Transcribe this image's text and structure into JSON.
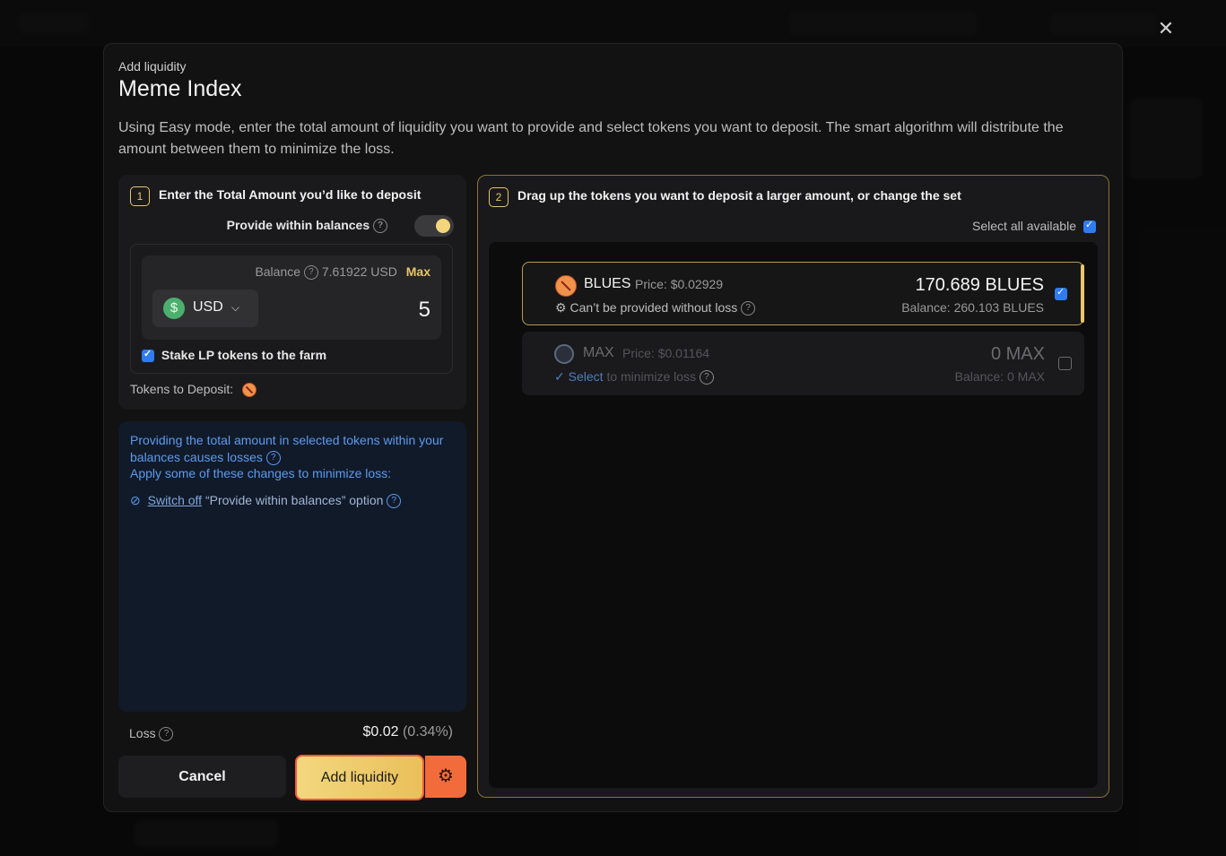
{
  "modal": {
    "subtitle": "Add liquidity",
    "title": "Meme Index",
    "description": "Using Easy mode, enter the total amount of liquidity you want to provide and select tokens you want to deposit. The smart algorithm will distribute the amount between them to minimize the loss.",
    "close_icon": "close-icon"
  },
  "step1": {
    "num": "1",
    "title": "Enter the Total Amount you’d like to deposit",
    "toggle_label": "Provide within balances",
    "toggle_on": true,
    "balance_label": "Balance",
    "balance_value": "7.61922 USD",
    "max_label": "Max",
    "currency": "USD",
    "currency_symbol": "$",
    "amount": "5",
    "stake_label": "Stake LP tokens to the farm",
    "stake_checked": true,
    "tokens_to_deposit_label": "Tokens to Deposit:"
  },
  "info": {
    "line1": "Providing the total amount in selected tokens within your balances causes losses",
    "line2": "Apply some of these changes to minimize loss:",
    "option_link": "Switch off",
    "option_text": "“Provide within balances” option"
  },
  "loss": {
    "label": "Loss",
    "value": "$0.02",
    "percent": "(0.34%)"
  },
  "actions": {
    "cancel_label": "Cancel",
    "add_label": "Add liquidity",
    "settings_icon": "gear-icon"
  },
  "step2": {
    "num": "2",
    "title": "Drag up the tokens you want to deposit a larger amount, or change the set",
    "select_all_label": "Select all available",
    "select_all_checked": true,
    "tokens": [
      {
        "symbol": "BLUES",
        "price_label": "Price:",
        "price": "$0.02929",
        "note": "Can’t be provided without loss",
        "amount": "170.689 BLUES",
        "balance_label": "Balance:",
        "balance": "260.103 BLUES",
        "checked": true
      },
      {
        "symbol": "MAX",
        "price_label": "Price:",
        "price": "$0.01164",
        "note_link": "Select",
        "note": "to minimize loss",
        "amount": "0 MAX",
        "balance_label": "Balance:",
        "balance": "0 MAX",
        "checked": false
      }
    ]
  },
  "colors": {
    "accent_gold": "#e9c46a",
    "accent_orange": "#f26b3a",
    "info_blue": "#5b9bf0",
    "check_blue": "#2f7cf0"
  }
}
